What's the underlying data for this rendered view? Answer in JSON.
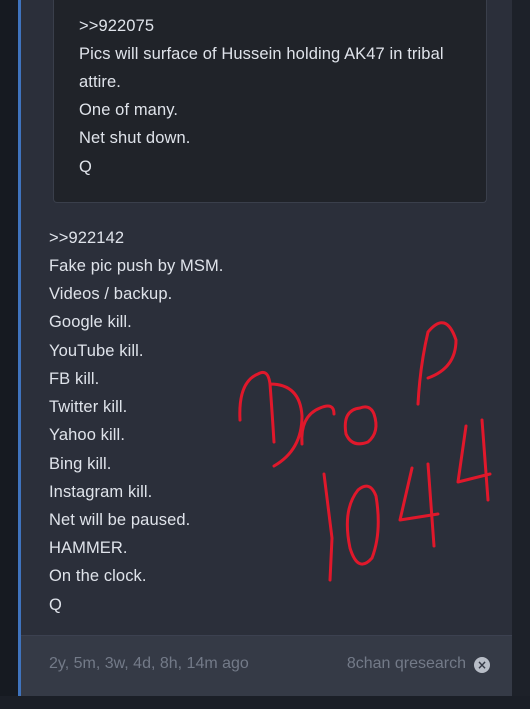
{
  "quoted_post": {
    "lines": [
      ">>922075",
      "Pics will surface of Hussein holding AK47 in tribal",
      "attire.",
      "One of many.",
      "Net shut down.",
      "Q"
    ]
  },
  "main_post": {
    "lines": [
      ">>922142",
      "Fake pic push by MSM.",
      "Videos / backup.",
      "Google kill.",
      "YouTube kill.",
      "FB kill.",
      "Twitter kill.",
      "Yahoo kill.",
      "Bing kill.",
      "Instagram kill.",
      "Net will be paused.",
      "HAMMER.",
      "On the clock.",
      "Q"
    ]
  },
  "footer": {
    "timestamp": "2y, 5m, 3w, 4d, 8h, 14m ago",
    "source": "8chan qresearch",
    "close_icon": "close-circle-icon"
  },
  "annotation": {
    "text": "Drop 1044",
    "color": "#e0182b"
  }
}
